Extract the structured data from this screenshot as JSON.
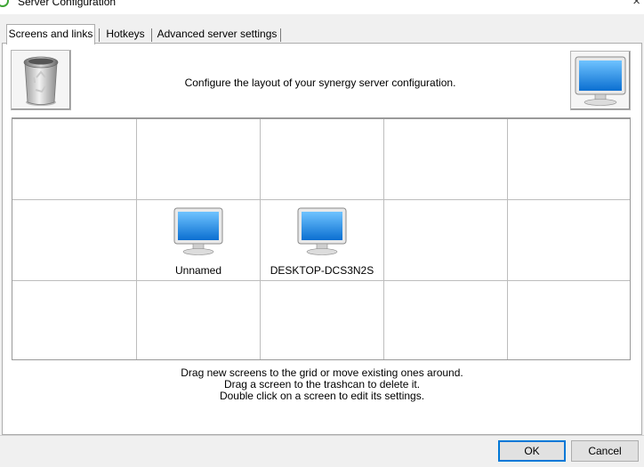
{
  "window": {
    "title": "Server Configuration",
    "close_glyph": "×",
    "app_icon": "synergy-ring-icon",
    "app_icon_color": "#3fa535"
  },
  "tabs": [
    {
      "label": "Screens and links",
      "active": true
    },
    {
      "label": "Hotkeys",
      "active": false
    },
    {
      "label": "Advanced server settings",
      "active": false
    }
  ],
  "screens_tab": {
    "header": "Configure the layout of your synergy server configuration.",
    "trash_icon": "trash-can-icon",
    "new_screen_icon": "monitor-icon",
    "grid": {
      "columns": 5,
      "rows": 3,
      "screens": [
        {
          "name": "Unnamed",
          "row": 2,
          "col": 2
        },
        {
          "name": "DESKTOP-DCS3N2S",
          "row": 2,
          "col": 3
        }
      ]
    },
    "help": [
      "Drag new screens to the grid or move existing ones around.",
      "Drag a screen to the trashcan to delete it.",
      "Double click on a screen to edit its settings."
    ]
  },
  "buttons": {
    "ok": "OK",
    "cancel": "Cancel"
  },
  "colors": {
    "monitor_screen": "#1b7fd6",
    "default_button_border": "#0078d7"
  }
}
